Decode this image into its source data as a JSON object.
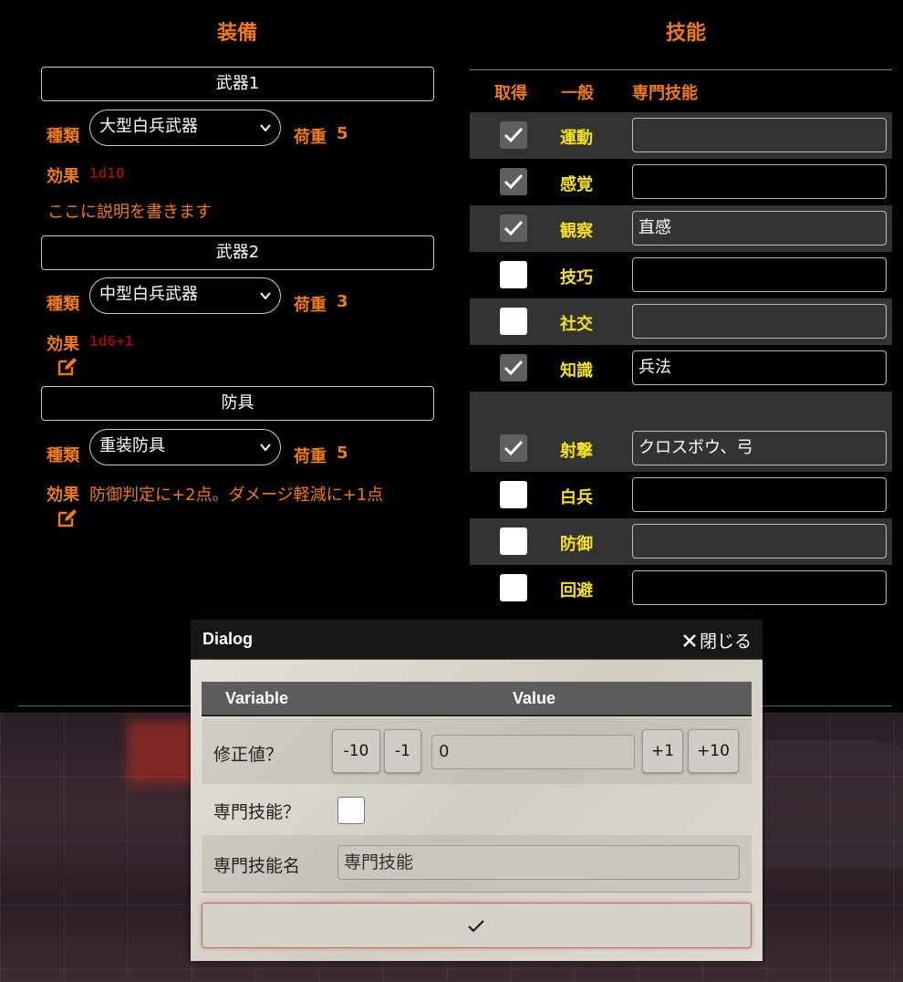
{
  "equipment": {
    "title": "装備",
    "type_label": "種類",
    "weight_label": "荷重",
    "effect_label": "効果",
    "items": [
      {
        "name": "武器1",
        "type": "大型白兵武器",
        "weight": "5",
        "effect": "1d10",
        "description": "ここに説明を書きます"
      },
      {
        "name": "武器2",
        "type": "中型白兵武器",
        "weight": "3",
        "effect": "1d6+1"
      },
      {
        "name": "防具",
        "type": "重装防具",
        "weight": "5",
        "effect": "防御判定に+2点。ダメージ軽減に+1点"
      }
    ]
  },
  "skills": {
    "title": "技能",
    "headers": {
      "acquired": "取得",
      "general": "一般",
      "specialty": "専門技能"
    },
    "rows": [
      {
        "name": "運動",
        "checked": true,
        "specialty": ""
      },
      {
        "name": "感覚",
        "checked": true,
        "specialty": ""
      },
      {
        "name": "観察",
        "checked": true,
        "specialty": "直感"
      },
      {
        "name": "技巧",
        "checked": false,
        "specialty": ""
      },
      {
        "name": "社交",
        "checked": false,
        "specialty": ""
      },
      {
        "name": "知識",
        "checked": true,
        "specialty": "兵法"
      },
      {
        "name": "射撃",
        "checked": true,
        "specialty": "クロスボウ、弓"
      },
      {
        "name": "白兵",
        "checked": false,
        "specialty": ""
      },
      {
        "name": "防御",
        "checked": false,
        "specialty": ""
      },
      {
        "name": "回避",
        "checked": false,
        "specialty": ""
      }
    ]
  },
  "dialog": {
    "title": "Dialog",
    "close_label": "閉じる",
    "col_variable": "Variable",
    "col_value": "Value",
    "modifier_label": "修正値？",
    "btn_minus10": "-10",
    "btn_minus1": "-1",
    "modifier_value": "0",
    "btn_plus1": "+1",
    "btn_plus10": "+10",
    "specialty_q_label": "専門技能？",
    "specialty_name_label": "専門技能名",
    "specialty_name_value": "専門技能"
  },
  "colors": {
    "accent": "#f07a19",
    "skill_name": "#f5e21a",
    "dice": "#8c0d0d"
  }
}
